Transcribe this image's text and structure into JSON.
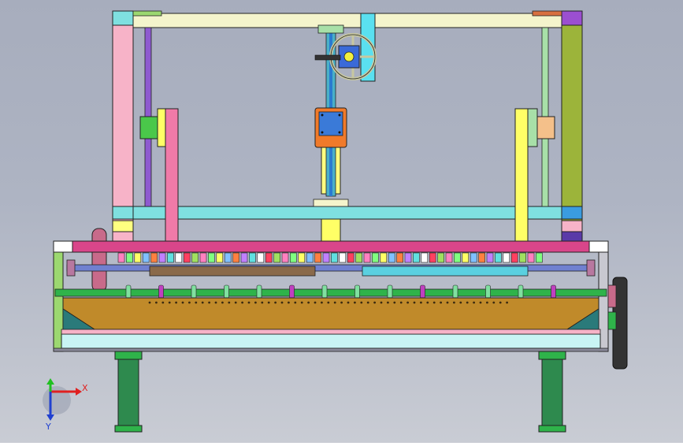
{
  "view": {
    "background_top": "#a7adbd",
    "background_bottom": "#c9ccd4"
  },
  "triad": {
    "x_label": "X",
    "y_label": "Y",
    "x_color": "#e02020",
    "y_color": "#2040d0",
    "z_color": "#20c020"
  },
  "palette": {
    "frame_cyan": "#7fe0e0",
    "post_pink": "#f7b3c8",
    "post_olive": "#9cb43a",
    "beam_cream": "#f4f4cc",
    "rail_green": "#2fb34a",
    "trough_ochre": "#c08a2a",
    "leg_green": "#2e8a4e",
    "magenta_bar": "#d9468a",
    "screw_blue": "#2a7ad0"
  }
}
